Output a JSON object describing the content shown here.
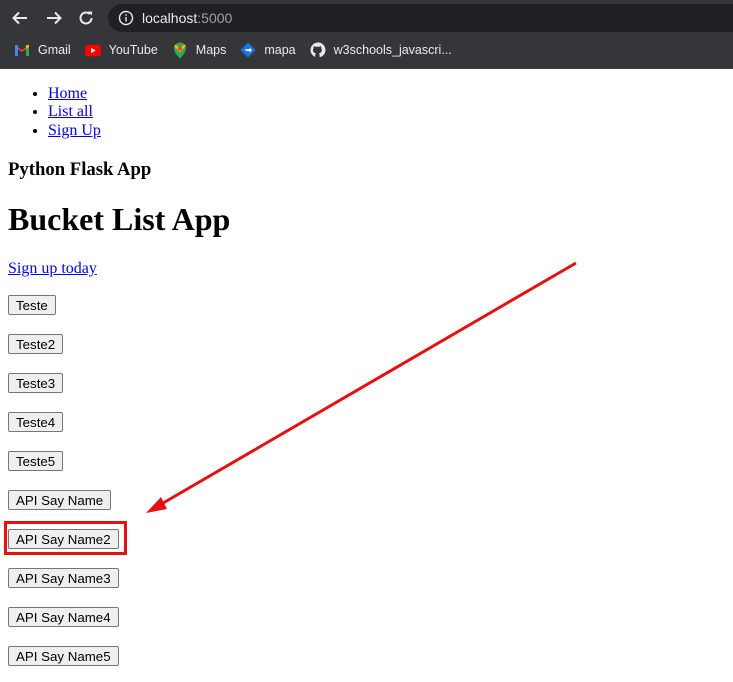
{
  "browser": {
    "url_host": "localhost",
    "url_port": ":5000",
    "bookmarks": [
      {
        "label": "Gmail",
        "icon": "gmail-icon"
      },
      {
        "label": "YouTube",
        "icon": "youtube-icon"
      },
      {
        "label": "Maps",
        "icon": "maps-icon"
      },
      {
        "label": "mapa",
        "icon": "mapa-icon"
      },
      {
        "label": "w3schools_javascri...",
        "icon": "github-icon"
      }
    ]
  },
  "page": {
    "nav": [
      {
        "label": "Home"
      },
      {
        "label": "List all"
      },
      {
        "label": "Sign Up"
      }
    ],
    "subtitle": "Python Flask App",
    "title": "Bucket List App",
    "signup_link": "Sign up today",
    "buttons": [
      {
        "label": "Teste"
      },
      {
        "label": "Teste2"
      },
      {
        "label": "Teste3"
      },
      {
        "label": "Teste4"
      },
      {
        "label": "Teste5"
      },
      {
        "label": "API Say Name"
      },
      {
        "label": "API Say Name2"
      },
      {
        "label": "API Say Name3"
      },
      {
        "label": "API Say Name4"
      },
      {
        "label": "API Say Name5"
      }
    ]
  },
  "colors": {
    "chrome_bg": "#35363a",
    "annotation": "#e51010",
    "link": "#0000ee"
  }
}
